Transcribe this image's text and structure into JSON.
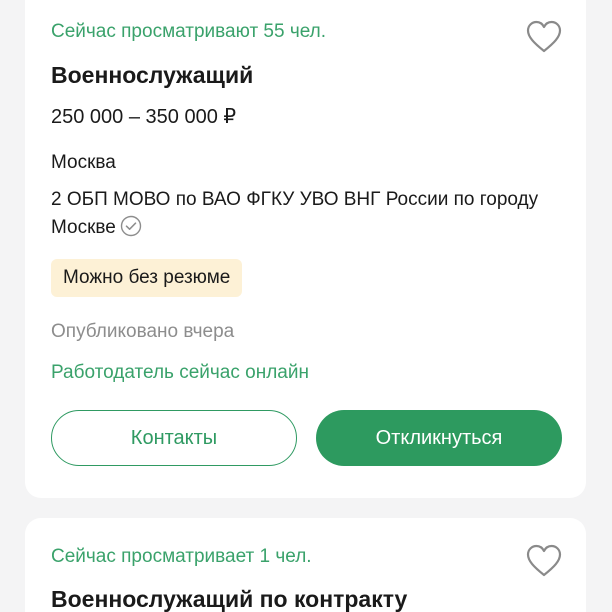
{
  "vacancies": [
    {
      "viewers": "Сейчас просматривают 55 чел.",
      "title": "Военнослужащий",
      "salary": "250 000 – 350 000 ₽",
      "city": "Москва",
      "company": "2 ОБП МОВО по ВАО ФГКУ УВО ВНГ России по городу Москве",
      "badge": "Можно без резюме",
      "published": "Опубликовано вчера",
      "employer_status": "Работодатель сейчас онлайн",
      "contacts_label": "Контакты",
      "apply_label": "Откликнуться"
    },
    {
      "viewers": "Сейчас просматривает 1 чел.",
      "title": "Военнослужащий по контракту"
    }
  ],
  "colors": {
    "accent_green": "#2d9a5f",
    "text_green": "#3aa26b",
    "badge_bg": "#fdf1d6",
    "muted_text": "#8d8d8d",
    "page_bg": "#f4f4f5"
  },
  "icons": {
    "favorite": "heart-outline-icon",
    "verified": "check-circle-icon"
  }
}
